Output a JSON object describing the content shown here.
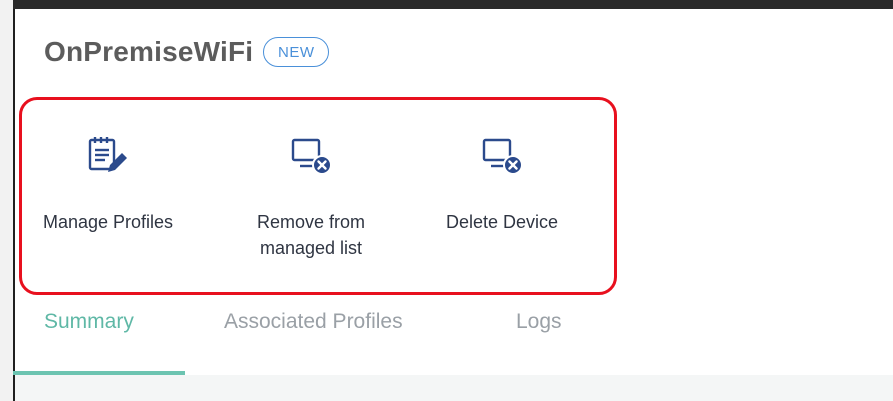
{
  "header": {
    "title": "OnPremiseWiFi",
    "badge": "NEW"
  },
  "actions": [
    {
      "label": "Manage Profiles",
      "icon": "manage-profiles-icon"
    },
    {
      "label": "Remove from\nmanaged list",
      "icon": "remove-device-icon"
    },
    {
      "label": "Delete Device",
      "icon": "delete-device-icon"
    }
  ],
  "tabs": [
    {
      "label": "Summary",
      "active": true
    },
    {
      "label": "Associated Profiles",
      "active": false
    },
    {
      "label": "Logs",
      "active": false
    }
  ],
  "colors": {
    "title": "#5c5c5c",
    "badge": "#4a90d9",
    "icon": "#2b4a8c",
    "highlight": "#e8101e",
    "active_tab": "#5fb8a6",
    "inactive_tab": "#9aa0a6"
  }
}
